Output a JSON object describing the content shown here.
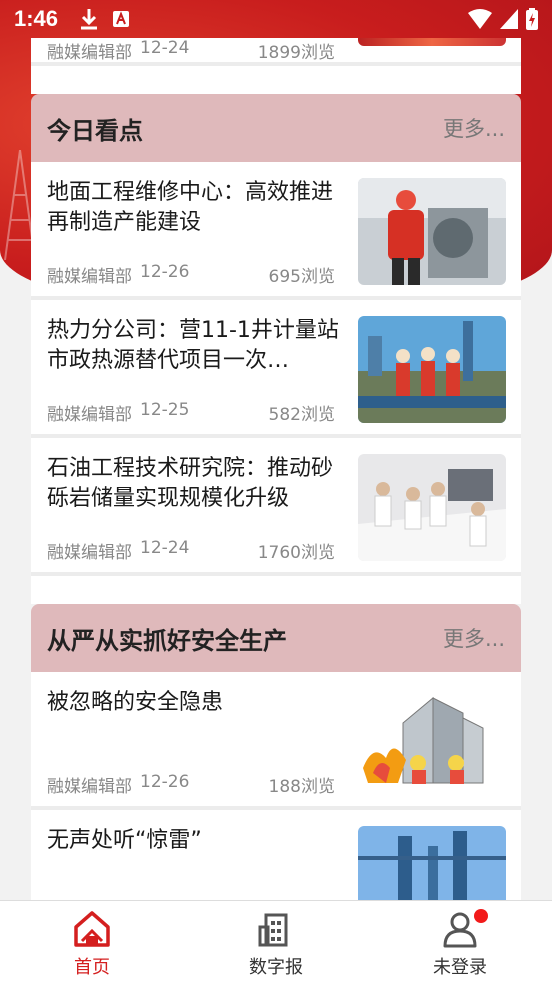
{
  "status": {
    "time": "1:46"
  },
  "top_partial": {
    "source": "融媒编辑部",
    "date": "12-24",
    "views": "1899浏览"
  },
  "sections": [
    {
      "title": "今日看点",
      "more": "更多...",
      "articles": [
        {
          "title": "地面工程维修中心：高效推进再制造产能建设",
          "source": "融媒编辑部",
          "date": "12-26",
          "views": "695浏览"
        },
        {
          "title": "热力分公司：营11-1井计量站市政热源替代项目一次…",
          "source": "融媒编辑部",
          "date": "12-25",
          "views": "582浏览"
        },
        {
          "title": "石油工程技术研究院：推动砂砾岩储量实现规模化升级",
          "source": "融媒编辑部",
          "date": "12-24",
          "views": "1760浏览"
        }
      ]
    },
    {
      "title": "从严从实抓好安全生产",
      "more": "更多...",
      "articles": [
        {
          "title": "被忽略的安全隐患",
          "source": "融媒编辑部",
          "date": "12-26",
          "views": "188浏览"
        },
        {
          "title": "无声处听“惊雷”",
          "source": "",
          "date": "",
          "views": ""
        }
      ]
    }
  ],
  "nav": {
    "home": "首页",
    "digital": "数字报",
    "login": "未登录"
  },
  "colors": {
    "accent": "#d41f1f",
    "section_head": "#dfb9bb"
  }
}
